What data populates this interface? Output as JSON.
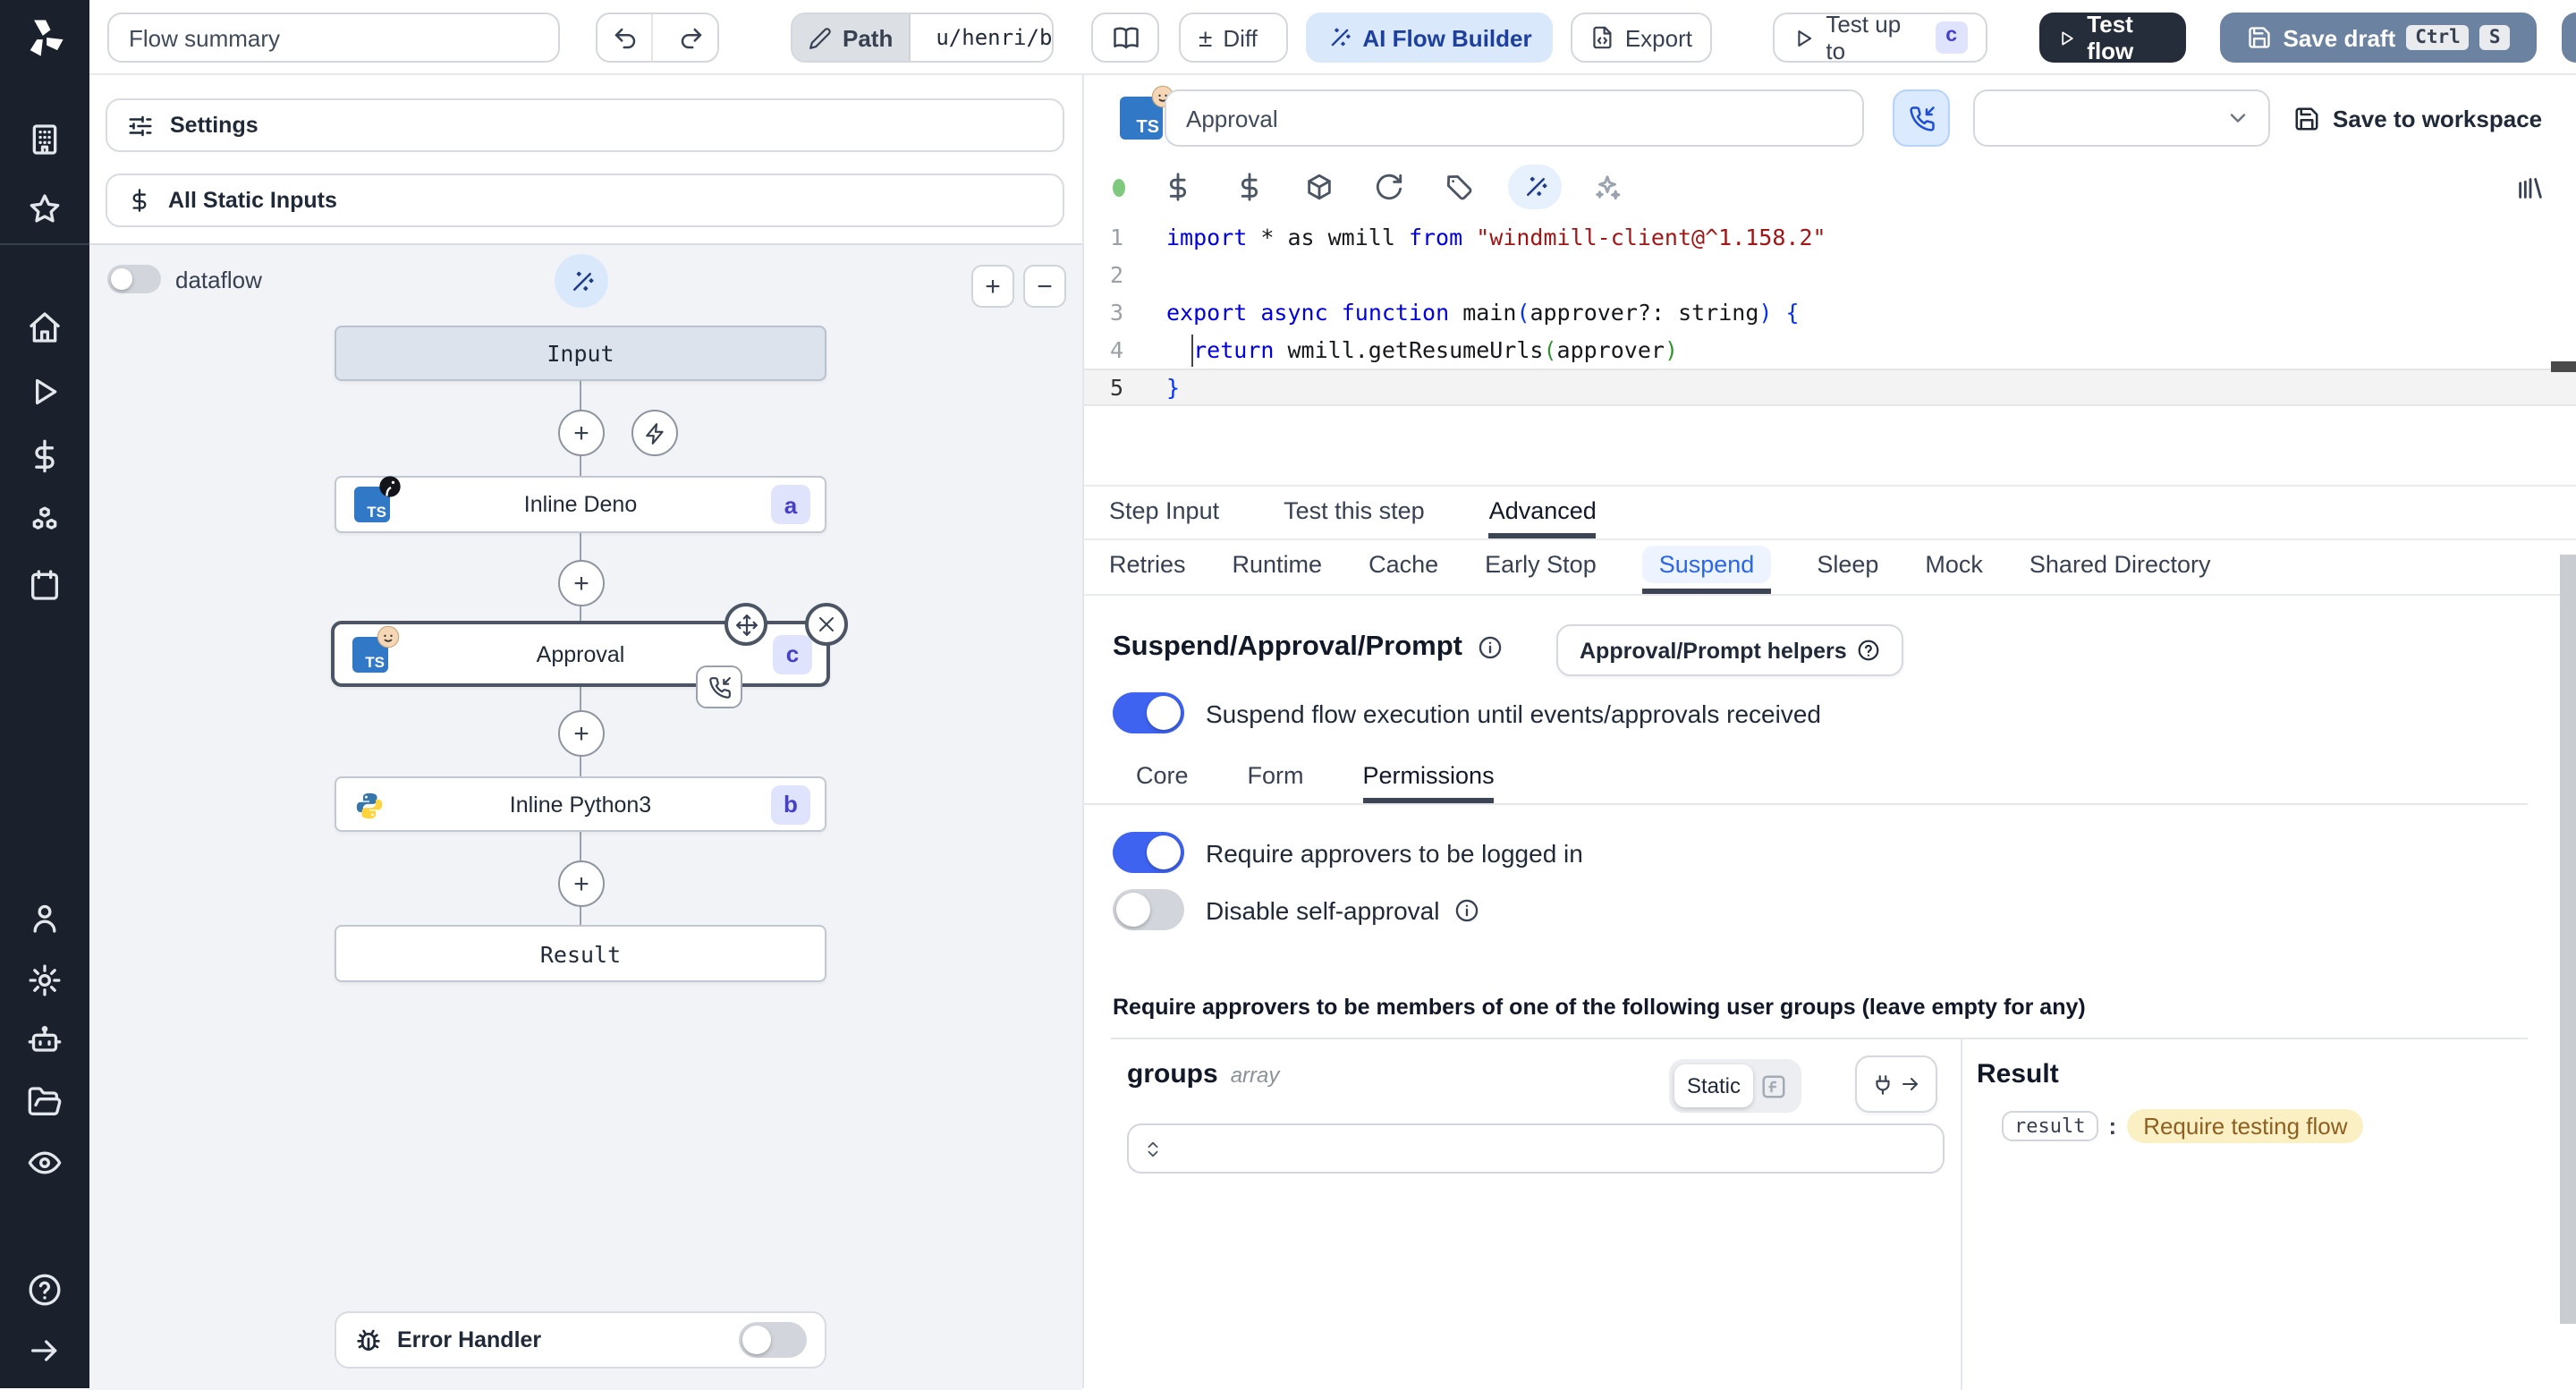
{
  "colors": {
    "sidebar_bg": "#1b212c",
    "accent_blue": "#3f63f1",
    "ai_button_bg": "#d9e8fb",
    "ai_button_text": "#1d3f9e",
    "dark_button_bg": "#252c3a",
    "save_draft_bg": "#6b82a1",
    "badge_bg": "#dfe4fc",
    "badge_text": "#4640c8",
    "ts_blue": "#3178c6",
    "suspend_tab_text": "#2a66e8",
    "result_value_bg": "#fbf0c4",
    "result_value_text": "#8d5f21",
    "status_dot_green": "#7fc97f"
  },
  "topbar": {
    "flow_summary_value": "Flow summary",
    "path_label": "Path",
    "path_value": "u/henri/bes",
    "diff_sign": "±",
    "diff_label": "Diff",
    "ai_flow_builder_label": "AI Flow Builder",
    "export_label": "Export",
    "test_up_to_label": "Test up to",
    "test_up_to_badge": "c",
    "test_flow_label": "Test flow",
    "save_draft_label": "Save draft",
    "save_draft_kbd": [
      "Ctrl",
      "S"
    ]
  },
  "sidebar": {
    "icons": [
      "building",
      "star",
      "home",
      "play",
      "dollar",
      "cubes",
      "calendar",
      "user",
      "gear",
      "robot",
      "folder",
      "eye",
      "help",
      "arrow-right"
    ]
  },
  "flow_panel": {
    "settings_label": "Settings",
    "static_inputs_label": "All Static Inputs",
    "dataflow_label": "dataflow",
    "zoom_in": "+",
    "zoom_out": "−",
    "nodes": {
      "input": {
        "label": "Input"
      },
      "deno": {
        "label": "Inline Deno",
        "badge": "a"
      },
      "approval": {
        "label": "Approval",
        "badge": "c"
      },
      "python": {
        "label": "Inline Python3",
        "badge": "b"
      },
      "result": {
        "label": "Result"
      }
    },
    "error_handler_label": "Error Handler"
  },
  "step_editor": {
    "title_value": "Approval",
    "save_to_workspace_label": "Save to workspace",
    "toolbar_icons": [
      "status-dot",
      "dollar",
      "dollar",
      "package",
      "refresh",
      "tag",
      "wand",
      "sparkles",
      "library"
    ],
    "code": {
      "lines": [
        {
          "n": "1",
          "toks": [
            [
              "k",
              "import"
            ],
            [
              "d",
              " * as wmill "
            ],
            [
              "k",
              "from"
            ],
            [
              "d",
              " "
            ],
            [
              "s",
              "\"windmill-client@^1.158.2\""
            ]
          ]
        },
        {
          "n": "2",
          "toks": []
        },
        {
          "n": "3",
          "toks": [
            [
              "k",
              "export"
            ],
            [
              "d",
              " "
            ],
            [
              "k",
              "async"
            ],
            [
              "d",
              " "
            ],
            [
              "k",
              "function"
            ],
            [
              "d",
              " main"
            ],
            [
              "b1",
              "("
            ],
            [
              "d",
              "approver?: string"
            ],
            [
              "b1",
              ")"
            ],
            [
              "d",
              " "
            ],
            [
              "b1",
              "{"
            ]
          ]
        },
        {
          "n": "4",
          "toks": [
            [
              "d",
              "  "
            ],
            [
              "k",
              "return"
            ],
            [
              "d",
              " wmill.getResumeUrls"
            ],
            [
              "b2",
              "("
            ],
            [
              "d",
              "approver"
            ],
            [
              "b2",
              ")"
            ]
          ]
        },
        {
          "n": "5",
          "toks": [
            [
              "b1",
              "}"
            ]
          ]
        }
      ]
    },
    "tabs": {
      "items": [
        "Step Input",
        "Test this step",
        "Advanced"
      ],
      "active": "Advanced"
    },
    "subtabs": {
      "items": [
        "Retries",
        "Runtime",
        "Cache",
        "Early Stop",
        "Suspend",
        "Sleep",
        "Mock",
        "Shared Directory"
      ],
      "active": "Suspend"
    },
    "suspend": {
      "heading": "Suspend/Approval/Prompt",
      "helpers_button_label": "Approval/Prompt helpers",
      "suspend_toggle_label": "Suspend flow execution until events/approvals received",
      "perm_tabs": {
        "items": [
          "Core",
          "Form",
          "Permissions"
        ],
        "active": "Permissions"
      },
      "logged_in_toggle_label": "Require approvers to be logged in",
      "self_approval_toggle_label": "Disable self-approval",
      "groups_note": "Require approvers to be members of one of the following user groups (leave empty for any)",
      "groups_field": {
        "name": "groups",
        "type": "array",
        "mode_label": "Static"
      },
      "result_panel": {
        "heading": "Result",
        "key": "result",
        "value": "Require testing flow"
      }
    }
  }
}
